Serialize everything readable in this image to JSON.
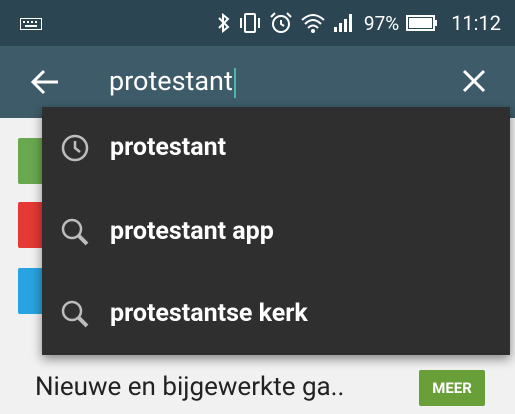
{
  "status_bar": {
    "battery_percent": "97%",
    "time": "11:12",
    "icons": [
      "keyboard-icon",
      "bluetooth-icon",
      "vibrate-icon",
      "alarm-icon",
      "wifi-icon",
      "signal-icon",
      "battery-icon"
    ]
  },
  "search": {
    "query": "protestant",
    "accent_color": "#4db6ac"
  },
  "suggestions": [
    {
      "label": "protestant",
      "icon": "history-icon"
    },
    {
      "label": "protestant app",
      "icon": "search-icon"
    },
    {
      "label": "protestantse kerk",
      "icon": "search-icon"
    }
  ],
  "section": {
    "title": "Nieuwe en bijgewerkte ga..",
    "more_label": "MEER"
  },
  "colors": {
    "status_bar": "#2b4552",
    "toolbar": "#3d5b69",
    "dropdown": "#2f2f2f",
    "more_button": "#689f38"
  }
}
